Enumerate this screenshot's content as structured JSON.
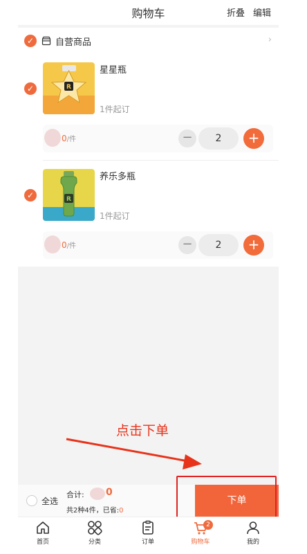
{
  "header": {
    "title": "购物车",
    "fold_label": "折叠",
    "edit_label": "编辑"
  },
  "store": {
    "name": "自营商品",
    "chevron": "›"
  },
  "items": [
    {
      "name": "星星瓶",
      "moq": "1件起订",
      "price_suffix": "0",
      "unit": "/件",
      "qty": "2",
      "minus": "−",
      "plus": "+"
    },
    {
      "name": "养乐多瓶",
      "moq": "1件起订",
      "price_suffix": "0",
      "unit": "/件",
      "qty": "2",
      "minus": "−",
      "plus": "+"
    }
  ],
  "annotation": {
    "text": "点击下单"
  },
  "checkout": {
    "select_all": "全选",
    "total_label": "合计:",
    "total_value": "0",
    "summary_prefix": "共2种4件，已省:",
    "summary_saved": "0",
    "order_button": "下单"
  },
  "tabs": [
    {
      "label": "首页",
      "icon": "home-icon"
    },
    {
      "label": "分类",
      "icon": "category-icon"
    },
    {
      "label": "订单",
      "icon": "order-icon"
    },
    {
      "label": "购物车",
      "icon": "cart-icon",
      "badge": "2",
      "active": true
    },
    {
      "label": "我的",
      "icon": "user-icon"
    }
  ],
  "colors": {
    "accent": "#ef6b3d",
    "annotation_red": "#e02020"
  }
}
